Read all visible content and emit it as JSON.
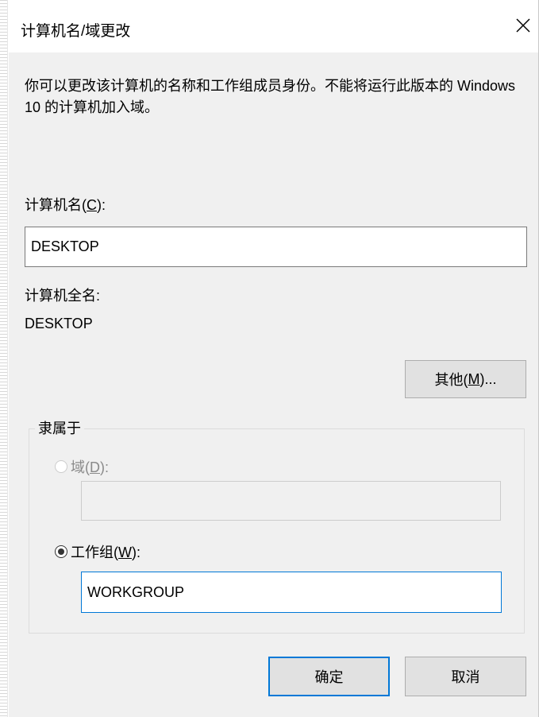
{
  "window": {
    "title": "计算机名/域更改",
    "close_icon": "close-icon"
  },
  "description": "你可以更改该计算机的名称和工作组成员身份。不能将运行此版本的 Windows 10 的计算机加入域。",
  "computer_name": {
    "label_prefix": "计算机名(",
    "label_key": "C",
    "label_suffix": "):",
    "value": "DESKTOP"
  },
  "full_name": {
    "label": "计算机全名:",
    "value": "DESKTOP"
  },
  "more_button": {
    "prefix": "其他(",
    "key": "M",
    "suffix": ")..."
  },
  "member_of": {
    "legend": "隶属于",
    "domain": {
      "prefix": "域(",
      "key": "D",
      "suffix": "):",
      "value": "",
      "checked": false,
      "enabled": false
    },
    "workgroup": {
      "prefix": "工作组(",
      "key": "W",
      "suffix": "):",
      "value": "WORKGROUP",
      "checked": true,
      "enabled": true
    }
  },
  "buttons": {
    "ok": "确定",
    "cancel": "取消"
  },
  "colors": {
    "accent": "#0078d7",
    "dialog_bg": "#f0f0f0",
    "disabled_text": "#8a8a8a"
  }
}
